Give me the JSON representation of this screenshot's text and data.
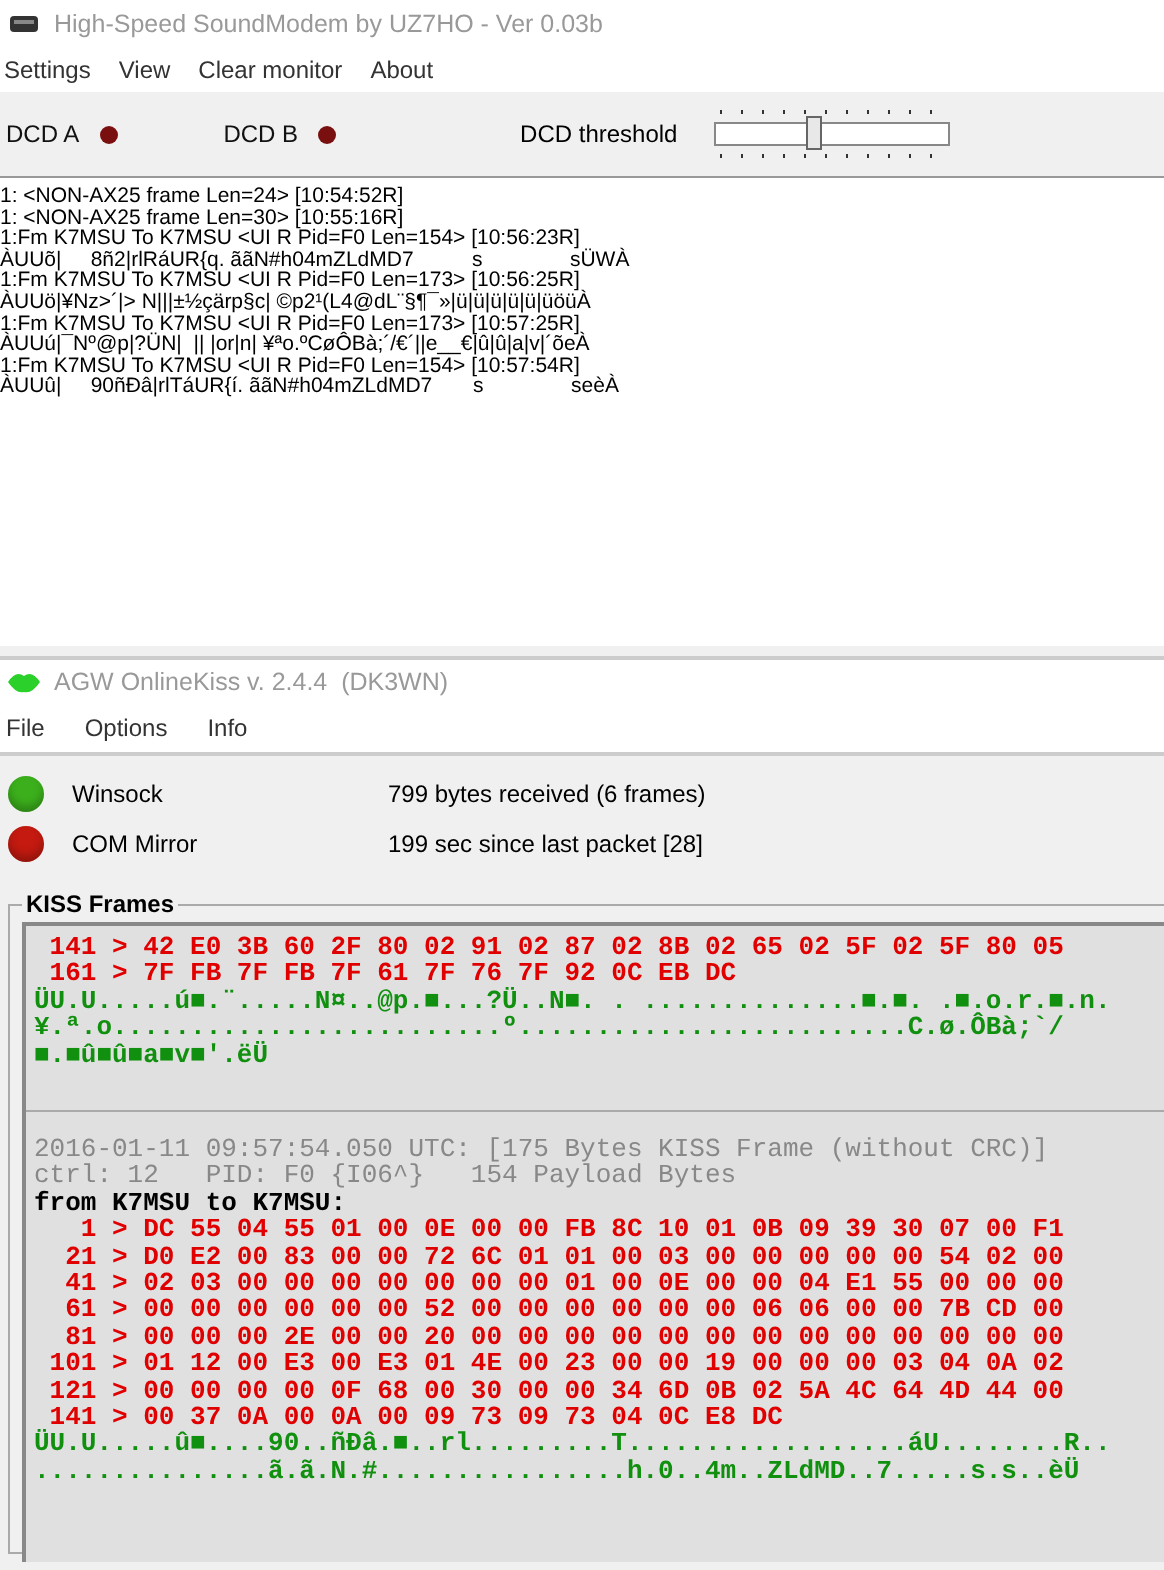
{
  "modem": {
    "title": "High-Speed SoundModem by UZ7HO - Ver 0.03b",
    "menu": [
      "Settings",
      "View",
      "Clear monitor",
      "About"
    ],
    "dcd": [
      {
        "label": "DCD A",
        "active": false
      },
      {
        "label": "DCD B",
        "active": false
      }
    ],
    "threshold": {
      "label": "DCD threshold",
      "level": 0.43
    },
    "monitor": [
      "1: <NON-AX25 frame Len=24> [10:54:52R]",
      "1: <NON-AX25 frame Len=30> [10:55:16R]",
      "1:Fm K7MSU To K7MSU <UI R Pid=F0 Len=154> [10:56:23R]",
      "ÀUUõ|     8ñ2|rlRáUR{q. ããN#h04mZLdMD7          s               sÜWÀ",
      "1:Fm K7MSU To K7MSU <UI R Pid=F0 Len=173> [10:56:25R]",
      "ÀUUö|¥Nz>´|> N|||±½çärp§c| ©p2¹(L4@dL¨§¶¯»|ü|ü|ü|ü|ü|üöüÀ",
      "1:Fm K7MSU To K7MSU <UI R Pid=F0 Len=173> [10:57:25R]",
      "ÀUUú|¯Nº@p|?ÜN|  || |or|n| ¥ªo.ºCøÔBà;´/€´||e__€|û|û|a|v|´õeÀ",
      "1:Fm K7MSU To K7MSU <UI R Pid=F0 Len=154> [10:57:54R]",
      "ÀUUû|     90ñÐâ|rlTáUR{í. ããN#h04mZLdMD7       s               seèÀ"
    ]
  },
  "kiss": {
    "title": "AGW OnlineKiss v. 2.4.4  (DK3WN)",
    "menu": [
      "File",
      "Options",
      "Info"
    ],
    "status": [
      {
        "label": "Winsock",
        "text": "799 bytes received (6 frames)",
        "color": "#3cb01c"
      },
      {
        "label": "COM Mirror",
        "text": "199 sec since last packet [28]",
        "color": "#c41a10"
      }
    ],
    "frames_title": "KISS Frames",
    "blocks": [
      [
        {
          "kind": "hex",
          "text": " 141 > 42 E0 3B 60 2F 80 02 91 02 87 02 8B 02 65 02 5F 02 5F 80 05"
        },
        {
          "kind": "hex",
          "text": " 161 > 7F FB 7F FB 7F 61 7F 76 7F 92 0C EB DC"
        },
        {
          "kind": "ascii",
          "text": "ÜU.U.....ú■.¨.....N¤..@p.■...?Ü..N■. . ..............■.■. .■.o.r.■.n."
        },
        {
          "kind": "ascii",
          "text": "¥.ª.o.........................º.........................C.ø.ÔBà;`/"
        },
        {
          "kind": "ascii",
          "text": "■.■û■û■a■v■'.ëÜ"
        }
      ],
      [
        {
          "kind": "meta",
          "text": "2016-01-11 09:57:54.050 UTC: [175 Bytes KISS Frame (without CRC)]"
        },
        {
          "kind": "meta",
          "text": "ctrl: 12   PID: F0 {I06^}   154 Payload Bytes"
        },
        {
          "kind": "header",
          "text": "from K7MSU to K7MSU:"
        },
        {
          "kind": "hex",
          "text": "   1 > DC 55 04 55 01 00 0E 00 00 FB 8C 10 01 0B 09 39 30 07 00 F1"
        },
        {
          "kind": "hex",
          "text": "  21 > D0 E2 00 83 00 00 72 6C 01 01 00 03 00 00 00 00 00 54 02 00"
        },
        {
          "kind": "hex",
          "text": "  41 > 02 03 00 00 00 00 00 00 00 01 00 0E 00 00 04 E1 55 00 00 00"
        },
        {
          "kind": "hex",
          "text": "  61 > 00 00 00 00 00 00 52 00 00 00 00 00 00 06 06 00 00 7B CD 00"
        },
        {
          "kind": "hex",
          "text": "  81 > 00 00 00 2E 00 00 20 00 00 00 00 00 00 00 00 00 00 00 00 00"
        },
        {
          "kind": "hex",
          "text": " 101 > 01 12 00 E3 00 E3 01 4E 00 23 00 00 19 00 00 00 03 04 0A 02"
        },
        {
          "kind": "hex",
          "text": " 121 > 00 00 00 00 0F 68 00 30 00 00 34 6D 0B 02 5A 4C 64 4D 44 00"
        },
        {
          "kind": "hex",
          "text": " 141 > 00 37 0A 00 0A 00 09 73 09 73 04 0C E8 DC"
        },
        {
          "kind": "ascii",
          "text": "ÜU.U.....û■....90..ñÐâ.■..rl.........T..................áU........R.."
        },
        {
          "kind": "ascii",
          "text": "...............ã.ã.N.#................h.0..4m..ZLdMD..7.....s.s..èÜ"
        }
      ]
    ]
  }
}
